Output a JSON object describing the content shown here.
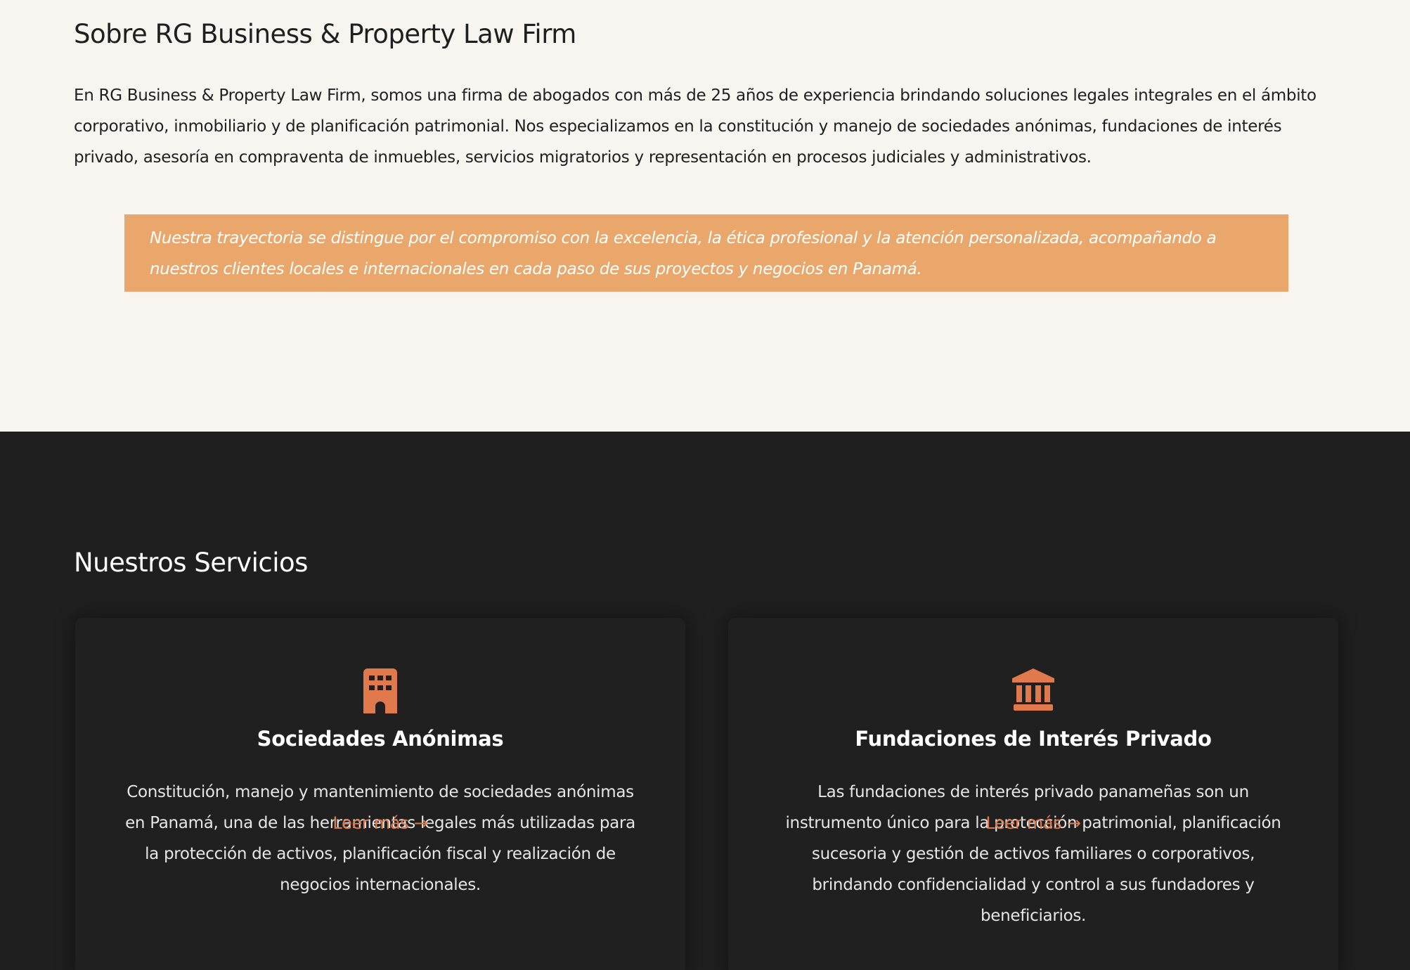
{
  "about": {
    "title": "Sobre RG Business & Property Law Firm",
    "paragraph": "En RG Business & Property Law Firm, somos una firma de abogados con más de 25 años de experiencia brindando soluciones legales integrales en el ámbito corporativo, inmobiliario y de planificación patrimonial. Nos especializamos en la constitución y manejo de sociedades anónimas, fundaciones de interés privado, asesoría en compraventa de inmuebles, servicios migratorios y representación en procesos judiciales y administrativos.",
    "quote": "Nuestra trayectoria se distingue por el compromiso con la excelencia, la ética profesional y la atención personalizada, acompañando a nuestros clientes locales e internacionales en cada paso de sus proyectos y negocios en Panamá."
  },
  "services": {
    "title": "Nuestros Servicios",
    "cards": [
      {
        "icon": "building-icon",
        "title": "Sociedades Anónimas",
        "text": "Constitución, manejo y mantenimiento de sociedades anónimas en Panamá, una de las herramientas legales más utilizadas para la protección de activos, planificación fiscal y realización de negocios internacionales.",
        "link": "Leer más →"
      },
      {
        "icon": "institution-icon",
        "title": "Fundaciones de Interés Privado",
        "text": "Las fundaciones de interés privado panameñas son un instrumento único para la protección patrimonial, planificación sucesoria y gestión de activos familiares o corporativos, brindando confidencialidad y control a sus fundadores y beneficiarios.",
        "link": "Leer más →"
      }
    ]
  },
  "colors": {
    "accent": "#e07a4c",
    "quote_bg": "#eaa76b",
    "dark_bg": "#1f1f1f",
    "light_bg": "#f8f5f1"
  }
}
